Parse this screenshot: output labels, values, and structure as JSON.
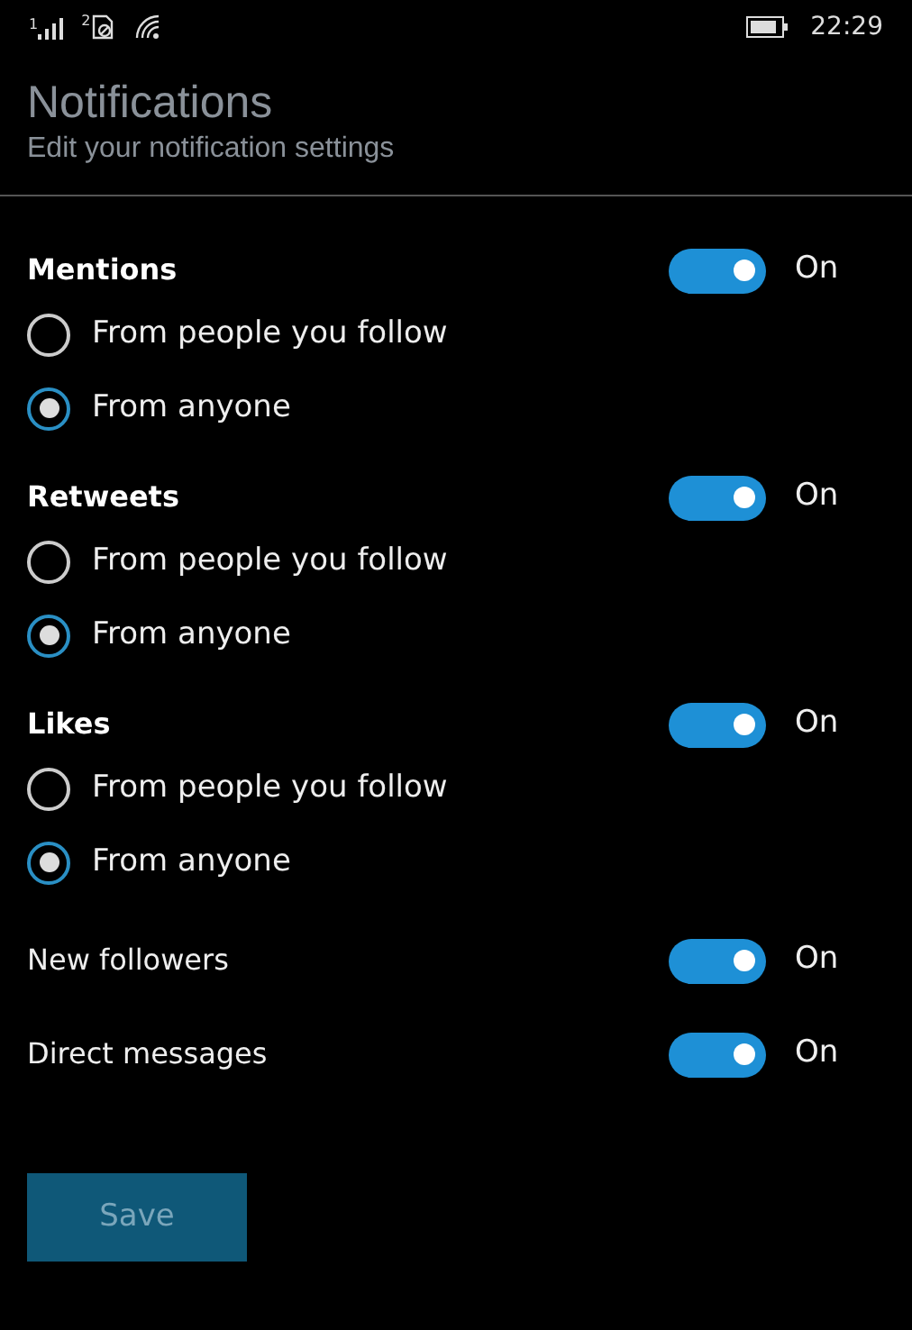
{
  "status_bar": {
    "sim1": "1",
    "sim2": "2",
    "time": "22:29"
  },
  "header": {
    "title": "Notifications",
    "subtitle": "Edit your notification settings"
  },
  "settings": [
    {
      "kind": "group",
      "label": "Mentions",
      "on": true,
      "state_text": "On",
      "options": [
        {
          "label": "From people you follow",
          "selected": false
        },
        {
          "label": "From anyone",
          "selected": true
        }
      ]
    },
    {
      "kind": "group",
      "label": "Retweets",
      "on": true,
      "state_text": "On",
      "options": [
        {
          "label": "From people you follow",
          "selected": false
        },
        {
          "label": "From anyone",
          "selected": true
        }
      ]
    },
    {
      "kind": "group",
      "label": "Likes",
      "on": true,
      "state_text": "On",
      "options": [
        {
          "label": "From people you follow",
          "selected": false
        },
        {
          "label": "From anyone",
          "selected": true
        }
      ]
    },
    {
      "kind": "simple",
      "label": "New followers",
      "on": true,
      "state_text": "On"
    },
    {
      "kind": "simple",
      "label": "Direct messages",
      "on": true,
      "state_text": "On"
    }
  ],
  "save_button": {
    "label": "Save",
    "disabled": true
  }
}
